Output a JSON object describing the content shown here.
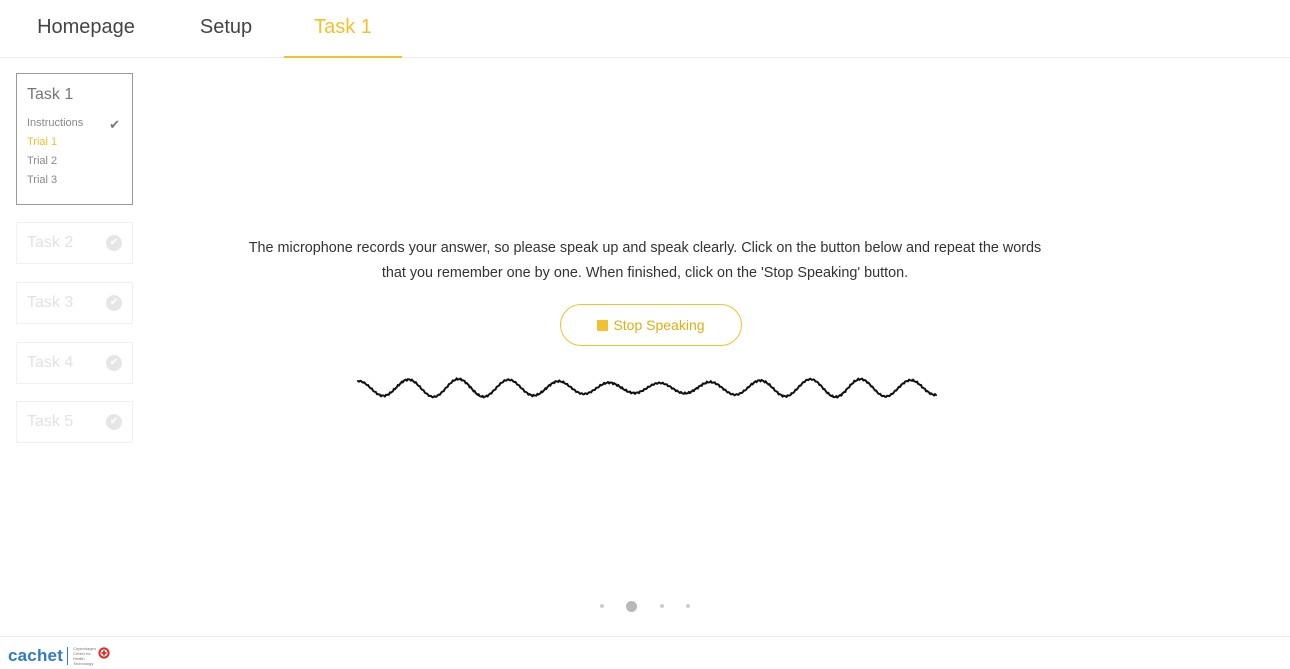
{
  "nav": {
    "tabs": [
      {
        "label": "Homepage"
      },
      {
        "label": "Setup"
      },
      {
        "label": "Task 1"
      }
    ]
  },
  "sidebar": {
    "active_task": {
      "title": "Task 1",
      "items": [
        {
          "label": "Instructions",
          "done": true
        },
        {
          "label": "Trial 1",
          "current": true
        },
        {
          "label": "Trial 2"
        },
        {
          "label": "Trial 3"
        }
      ]
    },
    "other_tasks": [
      {
        "title": "Task 2"
      },
      {
        "title": "Task 3"
      },
      {
        "title": "Task 4"
      },
      {
        "title": "Task 5"
      }
    ]
  },
  "main": {
    "instructions_line1": "The microphone records your answer, so please speak up and speak clearly. Click on the button below and repeat the words",
    "instructions_line2": "that you remember one by one. When finished, click on the 'Stop Speaking' button.",
    "stop_button_label": "Stop Speaking"
  },
  "pager": {
    "total": 4,
    "active_index": 1
  },
  "footer": {
    "brand_name": "cachet",
    "brand_sub": "Copenhagen Center for Health Technology"
  },
  "colors": {
    "accent": "#f2c12e",
    "brand": "#2f7dbf",
    "text": "#333333"
  },
  "icons": {
    "check": "check-icon",
    "check_circle": "check-circle-icon",
    "stop": "stop-icon",
    "waveform": "waveform-icon",
    "logo": "cachet-logo-icon"
  }
}
